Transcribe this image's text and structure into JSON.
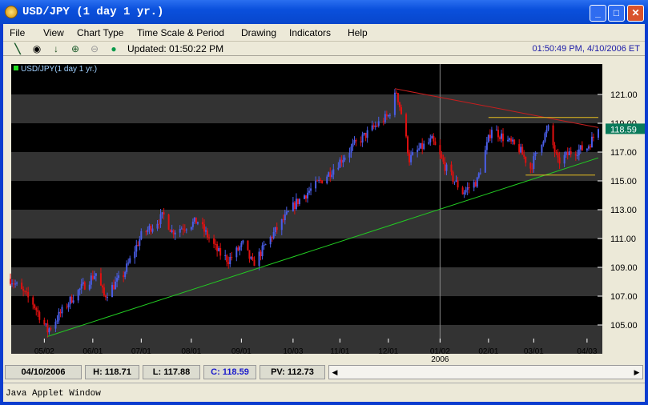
{
  "window": {
    "title": "USD/JPY (1 day  1 yr.)",
    "minimize": "_",
    "maximize": "□",
    "close": "✕"
  },
  "menu": [
    "File",
    "View",
    "Chart Type",
    "Time Scale & Period",
    "Drawing",
    "Indicators",
    "Help"
  ],
  "toolbar": {
    "icons": [
      "draw-line-icon",
      "crosshair-icon",
      "down-arrow-icon",
      "zoom-in-icon",
      "zoom-out-icon",
      "status-light-icon"
    ],
    "updated": "Updated: 01:50:22 PM",
    "clock": "01:50:49 PM, 4/10/2006 ET"
  },
  "status": {
    "date": "04/10/2006",
    "high": "H: 118.71",
    "low": "L: 117.88",
    "close": "C: 118.59",
    "pv": "PV: 112.73"
  },
  "applet_label": "Java Applet Window",
  "colors": {
    "up": "#4a5ee8",
    "down": "#e01010",
    "last_price_bg": "#0a7a5a",
    "resistance": "#c81e1e",
    "support": "#22cc22",
    "channel": "#e8c020",
    "close_text": "#1a1acc"
  },
  "chart_data": {
    "type": "candlestick",
    "legend": "USD/JPY(1 day  1 yr.)",
    "x_range": [
      "2005-04-11",
      "2006-04-10"
    ],
    "ylim": [
      103.9,
      123.1
    ],
    "y_ticks": [
      "121.00",
      "119.00",
      "117.00",
      "115.00",
      "113.00",
      "111.00",
      "109.00",
      "107.00",
      "105.00"
    ],
    "x_ticks": [
      {
        "date": "2005-05-02",
        "label": "05/02"
      },
      {
        "date": "2005-06-01",
        "label": "06/01"
      },
      {
        "date": "2005-07-01",
        "label": "07/01"
      },
      {
        "date": "2005-08-01",
        "label": "08/01"
      },
      {
        "date": "2005-09-01",
        "label": "09/01"
      },
      {
        "date": "2005-10-03",
        "label": "10/03"
      },
      {
        "date": "2005-11-01",
        "label": "11/01"
      },
      {
        "date": "2005-12-01",
        "label": "12/01"
      },
      {
        "date": "2006-01-02",
        "label": "01/02",
        "sub": "2006"
      },
      {
        "date": "2006-02-01",
        "label": "02/01"
      },
      {
        "date": "2006-03-01",
        "label": "03/01"
      },
      {
        "date": "2006-04-03",
        "label": "04/03"
      }
    ],
    "last_price": "118.59",
    "grid": "alternating bands",
    "approx_closes": [
      [
        "2005-04-11",
        108.2
      ],
      [
        "2005-04-25",
        106.5
      ],
      [
        "2005-05-04",
        104.6
      ],
      [
        "2005-05-20",
        107.0
      ],
      [
        "2005-06-03",
        108.6
      ],
      [
        "2005-06-08",
        107.0
      ],
      [
        "2005-06-20",
        108.5
      ],
      [
        "2005-07-01",
        111.2
      ],
      [
        "2005-07-15",
        112.6
      ],
      [
        "2005-07-20",
        111.5
      ],
      [
        "2005-08-05",
        112.2
      ],
      [
        "2005-08-18",
        110.0
      ],
      [
        "2005-08-24",
        109.5
      ],
      [
        "2005-09-02",
        110.6
      ],
      [
        "2005-09-08",
        109.2
      ],
      [
        "2005-09-20",
        111.2
      ],
      [
        "2005-10-05",
        113.5
      ],
      [
        "2005-10-25",
        115.5
      ],
      [
        "2005-11-10",
        117.5
      ],
      [
        "2005-11-25",
        119.0
      ],
      [
        "2005-12-01",
        119.5
      ],
      [
        "2005-12-06",
        121.2
      ],
      [
        "2005-12-10",
        119.2
      ],
      [
        "2005-12-14",
        116.5
      ],
      [
        "2005-12-20",
        117.2
      ],
      [
        "2005-12-28",
        117.8
      ],
      [
        "2006-01-06",
        115.8
      ],
      [
        "2006-01-16",
        114.2
      ],
      [
        "2006-01-25",
        115.0
      ],
      [
        "2006-02-03",
        118.7
      ],
      [
        "2006-02-10",
        118.0
      ],
      [
        "2006-02-20",
        117.2
      ],
      [
        "2006-02-27",
        115.9
      ],
      [
        "2006-03-06",
        117.8
      ],
      [
        "2006-03-10",
        118.6
      ],
      [
        "2006-03-16",
        116.3
      ],
      [
        "2006-03-24",
        117.0
      ],
      [
        "2006-04-03",
        117.3
      ],
      [
        "2006-04-10",
        118.59
      ]
    ],
    "trendlines": [
      {
        "name": "resistance",
        "from": [
          "2005-12-05",
          121.4
        ],
        "to": [
          "2006-04-10",
          118.7
        ]
      },
      {
        "name": "support",
        "from": [
          "2005-05-04",
          104.2
        ],
        "to": [
          "2006-04-10",
          116.6
        ]
      },
      {
        "name": "channel-top",
        "from": [
          "2006-02-01",
          119.4
        ],
        "to": [
          "2006-04-10",
          119.4
        ]
      },
      {
        "name": "channel-bottom",
        "from": [
          "2006-02-24",
          115.4
        ],
        "to": [
          "2006-04-08",
          115.4
        ]
      }
    ],
    "marker_date": "2006-01-02"
  }
}
